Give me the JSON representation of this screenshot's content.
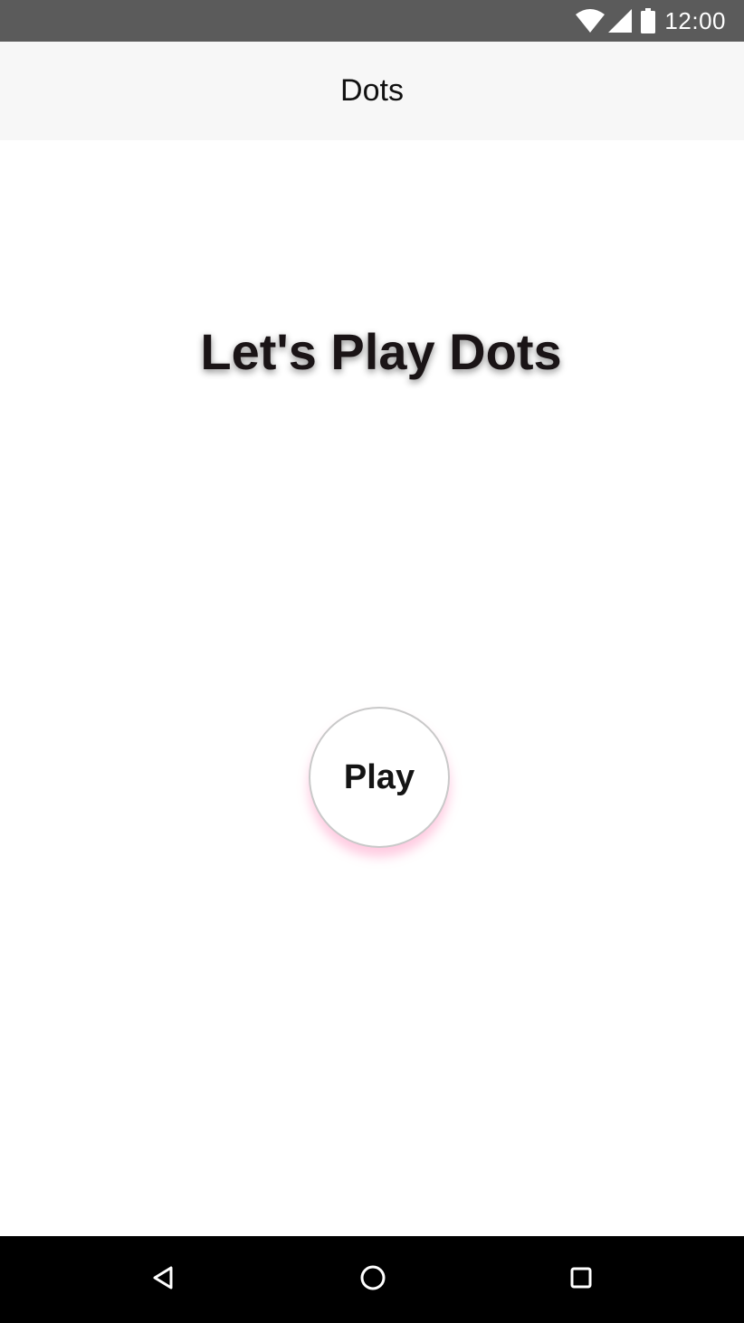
{
  "status_bar": {
    "time": "12:00",
    "icons": [
      "wifi-icon",
      "signal-icon",
      "battery-icon"
    ]
  },
  "app_bar": {
    "title": "Dots"
  },
  "main": {
    "headline": "Let's Play Dots",
    "play_button_label": "Play"
  },
  "nav_bar": {
    "icons": [
      "back-icon",
      "home-icon",
      "recents-icon"
    ]
  },
  "colors": {
    "status_bar_bg": "#5b5b5b",
    "app_bar_bg": "#f7f7f7",
    "background": "#ffffff",
    "nav_bar_bg": "#000000",
    "play_button_glow": "#ff69aa"
  }
}
